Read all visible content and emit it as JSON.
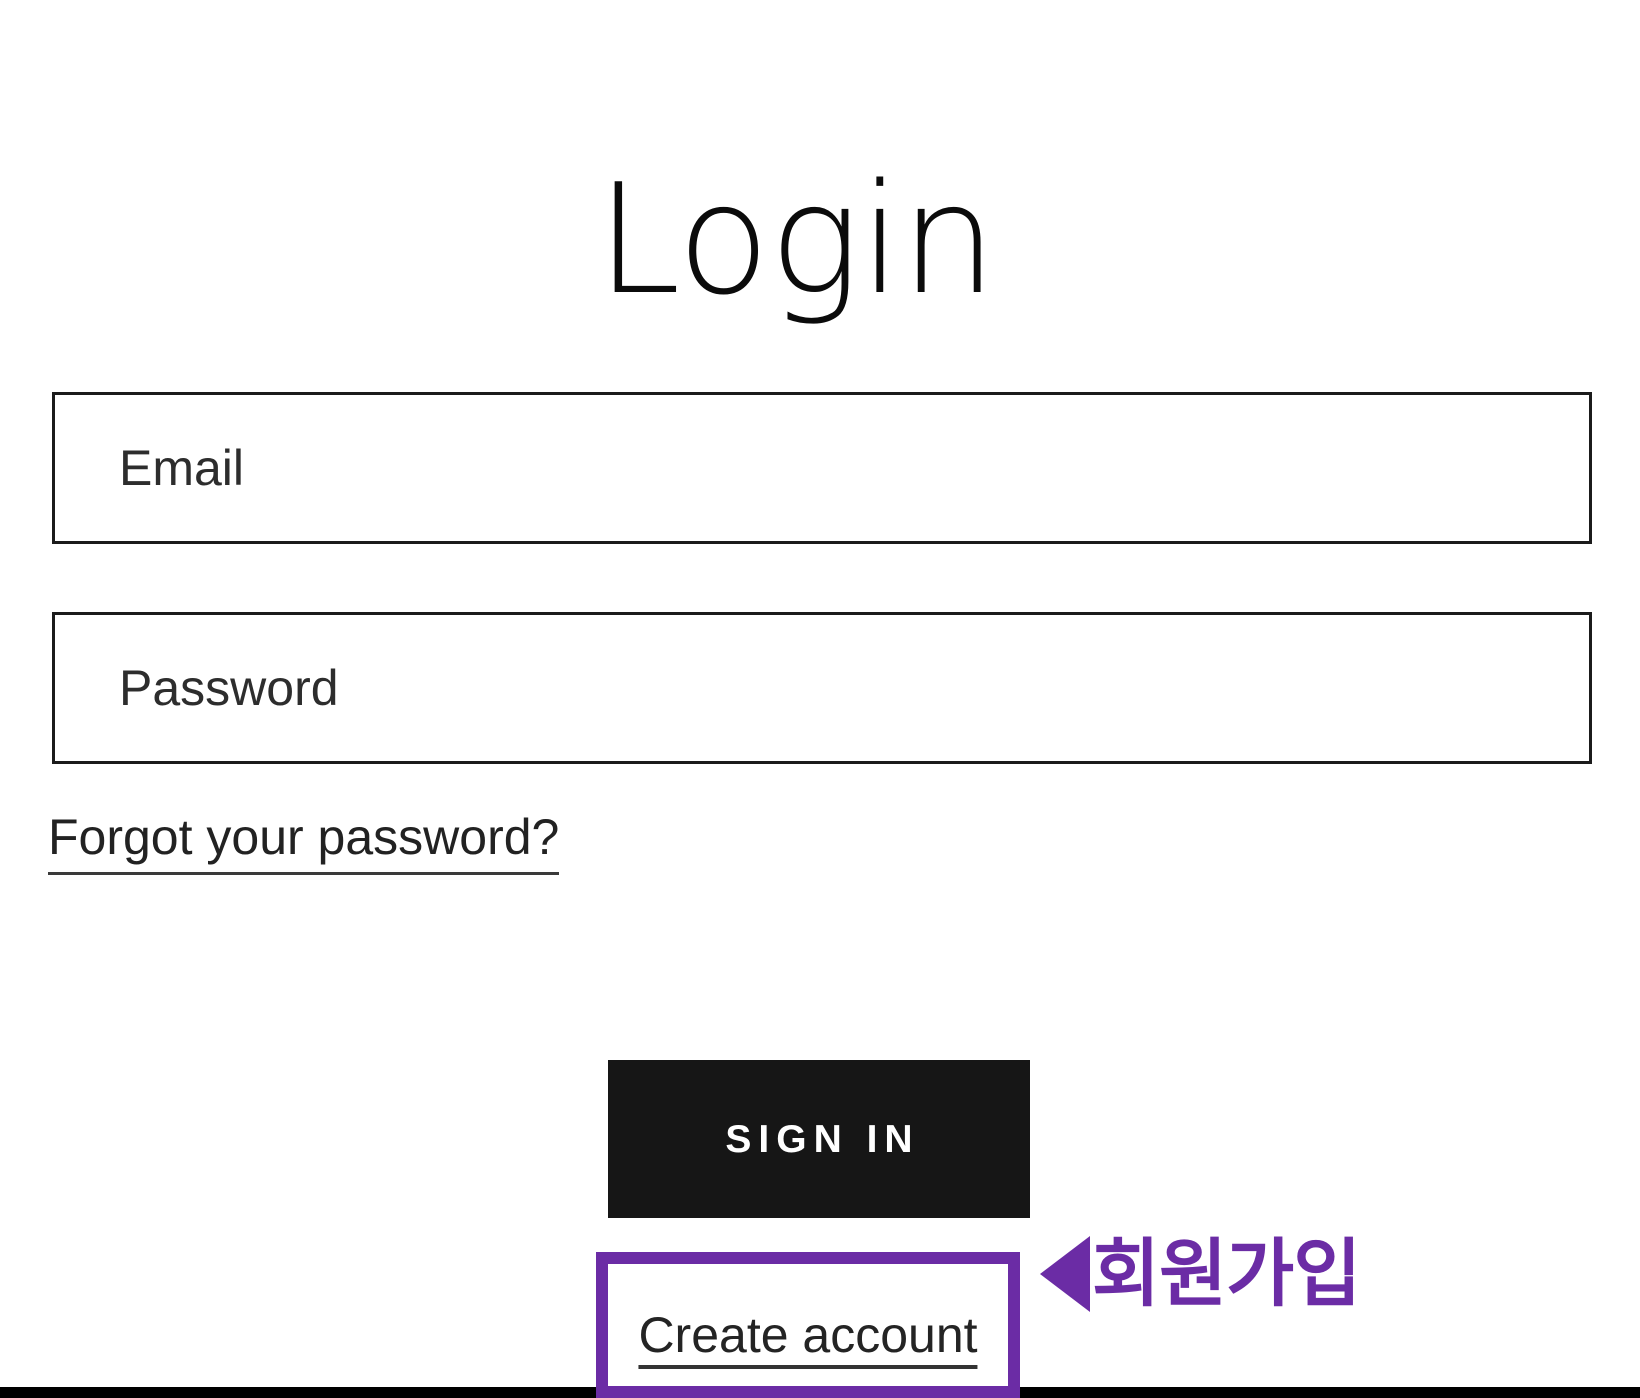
{
  "page": {
    "title": "Login",
    "background_color": "#ffffff"
  },
  "form": {
    "email": {
      "placeholder": "Email",
      "value": ""
    },
    "password": {
      "placeholder": "Password",
      "value": ""
    },
    "forgot_password_label": "Forgot your password?",
    "submit_label": "SIGN IN",
    "create_account_label": "Create account"
  },
  "annotation": {
    "arrow_icon": "triangle-left-icon",
    "text": "회원가입",
    "color": "#6B2CA5"
  },
  "colors": {
    "accent_purple": "#6B2CA5",
    "button_background": "#161616",
    "button_text": "#ffffff",
    "field_border": "#1b1b1b",
    "text_primary": "#0b0b0b",
    "text_secondary": "#2d2d2d",
    "bottom_bar": "#000000"
  }
}
